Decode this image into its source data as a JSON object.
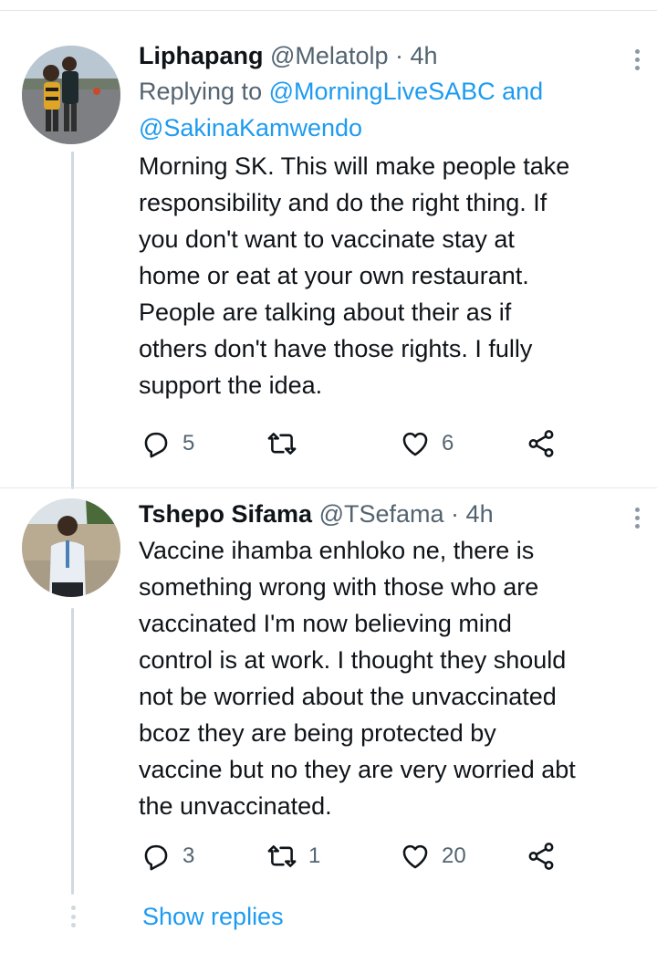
{
  "tweets": [
    {
      "name": "Liphapang",
      "handle": "@Melatolp",
      "separator": "·",
      "time": "4h",
      "replying_prefix": "Replying to",
      "replying_mention1": "@MorningLiveSABC",
      "replying_and": "and",
      "replying_mention2": "@SakinaKamwendo",
      "body_lines": [
        "Morning SK. This will make people take",
        "responsibility and do the right thing. If",
        "you don't want to vaccinate stay at",
        "home or eat at your own restaurant.",
        "People are talking about their as if",
        "others don't have those rights. I fully",
        "support the idea."
      ],
      "replies": "5",
      "retweets": "",
      "likes": "6"
    },
    {
      "name": "Tshepo Sifama",
      "handle": "@TSefama",
      "separator": "·",
      "time": "4h",
      "body_lines": [
        "Vaccine ihamba enhloko ne, there is",
        "something wrong with those who are",
        "vaccinated I'm now believing mind",
        "control is at work. I thought they should",
        "not be worried about the unvaccinated",
        "bcoz they are being protected by",
        "vaccine but no they are very worried abt",
        "the unvaccinated."
      ],
      "replies": "3",
      "retweets": "1",
      "likes": "20"
    }
  ],
  "footer": {
    "show_replies": "Show replies"
  },
  "icons": {
    "reply": "reply-bubble-icon",
    "retweet": "retweet-icon",
    "like": "heart-icon",
    "share": "share-icon",
    "more": "more-vertical-icon"
  },
  "colors": {
    "link": "#1d9bf0",
    "text": "#0f1419",
    "muted": "#536471",
    "thread_line": "#cfd9de"
  }
}
